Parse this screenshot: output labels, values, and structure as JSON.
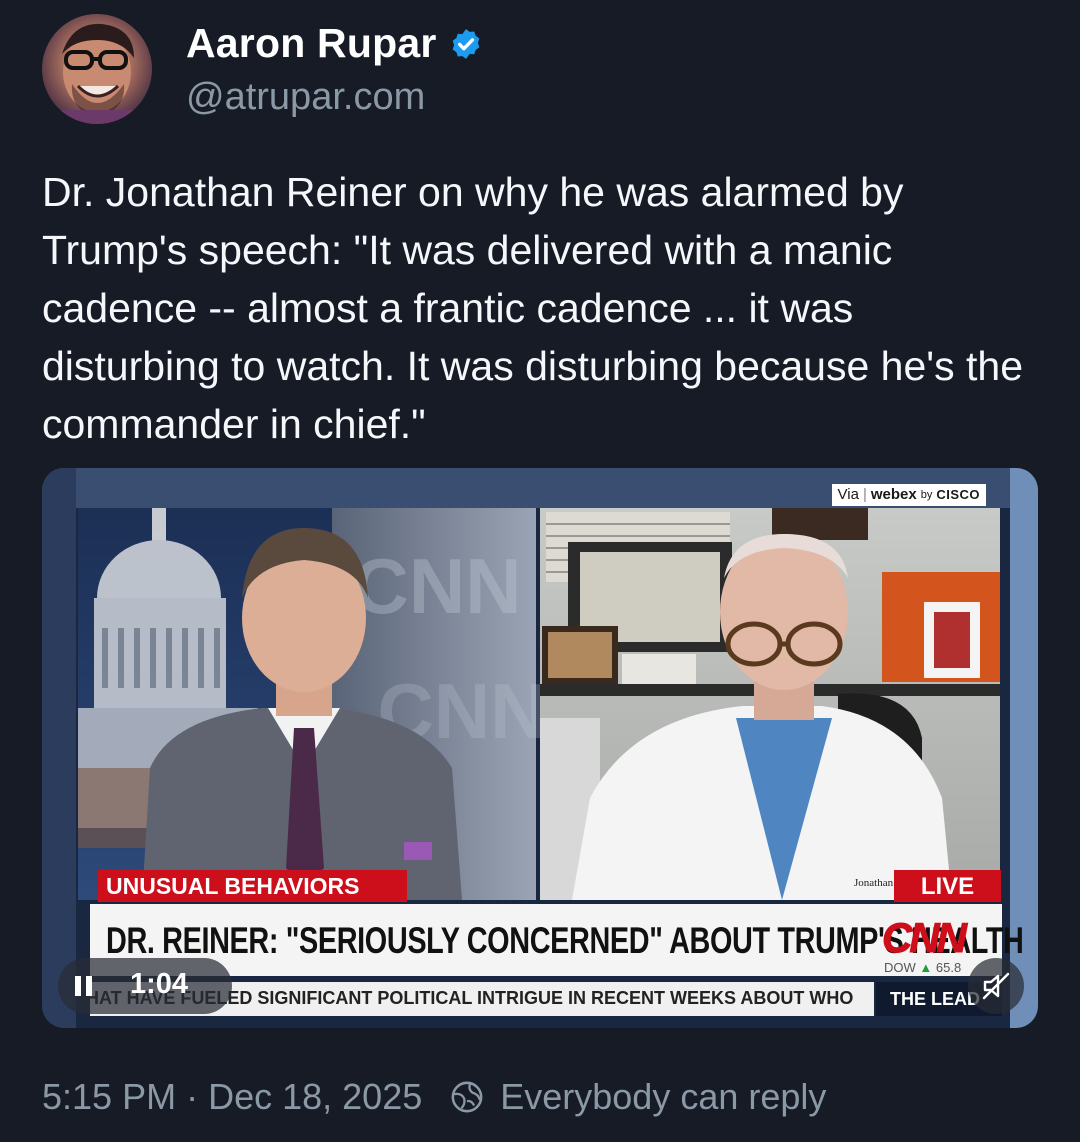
{
  "author": {
    "display_name": "Aaron Rupar",
    "handle": "@atrupar.com",
    "verified_color": "#1d9bf0"
  },
  "post": {
    "text": "Dr. Jonathan Reiner on why he was alarmed by Trump's speech: \"It was delivered with a manic cadence -- almost a frantic cadence ... it was disturbing to watch. It was disturbing because he's the commander in chief.\""
  },
  "video": {
    "webex": {
      "via": "Via",
      "brand": "webex",
      "by": "by",
      "partner": "CISCO"
    },
    "network_bg_text": "CNN",
    "nameplate": "Jonathan",
    "category_tag": "UNUSUAL BEHAVIORS",
    "live_tag": "LIVE",
    "headline": "DR. REINER: \"SERIOUSLY CONCERNED\" ABOUT TRUMP'S HEALTH",
    "logo": "CNN",
    "dow_label": "DOW",
    "dow_value": "65.8",
    "ticker": "HAT HAVE FUELED SIGNIFICANT POLITICAL INTRIGUE IN RECENT WEEKS ABOUT WHO",
    "show_name": "THE LEAD",
    "elapsed_time": "1:04",
    "brand_red": "#cc0f1a"
  },
  "footer": {
    "time": "5:15 PM",
    "separator": "·",
    "date": "Dec 18, 2025",
    "reply_setting": "Everybody can reply"
  }
}
